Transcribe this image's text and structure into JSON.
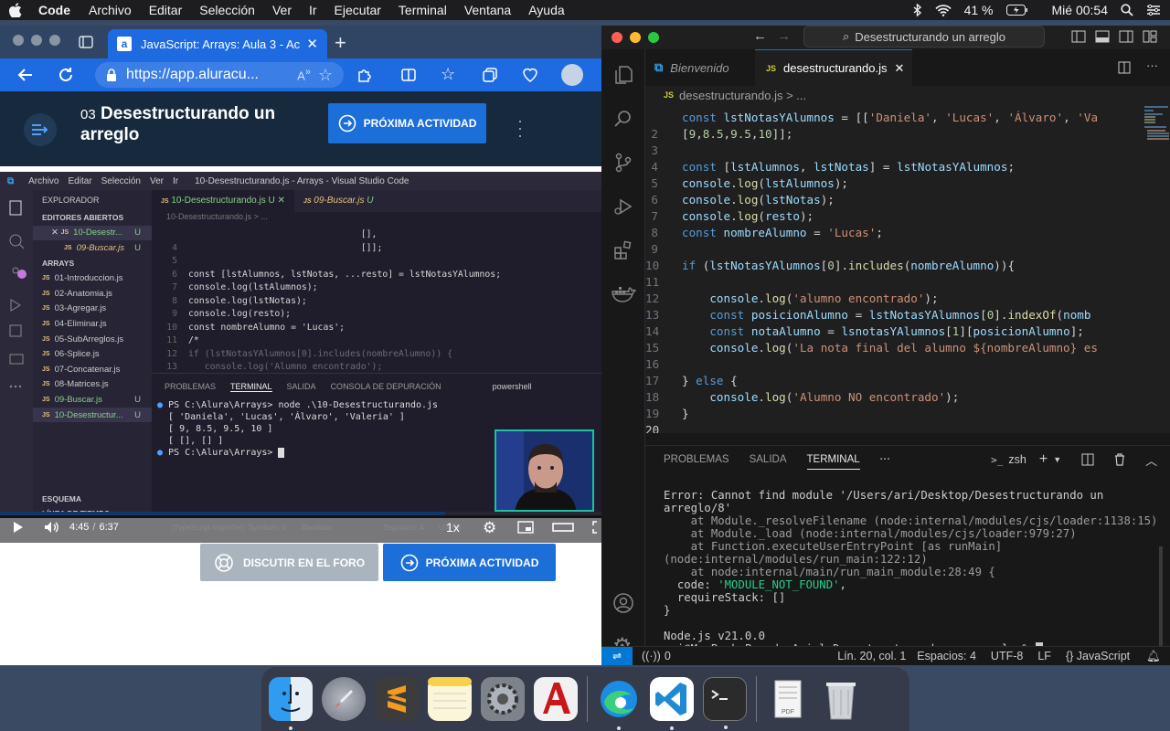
{
  "menubar": {
    "apple": "",
    "app": "Code",
    "items": [
      "Archivo",
      "Editar",
      "Selección",
      "Ver",
      "Ir",
      "Ejecutar",
      "Terminal",
      "Ventana",
      "Ayuda"
    ],
    "battery": "41 %",
    "clock": "Mié 00:54"
  },
  "browser": {
    "tab_title": "JavaScript: Arrays: Aula 3 - Ac",
    "url": "https://app.aluracu...",
    "lesson_number": "03",
    "lesson_title": "Desestructurando un arreglo",
    "next_activity": "PRÓXIMA ACTIVIDAD",
    "forum_button": "DISCUTIR EN EL FORO",
    "next_activity_bottom": "PRÓXIMA ACTIVIDAD",
    "video": {
      "time_current": "4:45",
      "time_total": "6:37",
      "speed": "1x",
      "progress": 0.74,
      "inner_titlebar": {
        "menu": [
          "Archivo",
          "Editar",
          "Selección",
          "Ver",
          "Ir"
        ],
        "title": "10-Desestructurando.js - Arrays - Visual Studio Code"
      },
      "explorer_label": "EXPLORADOR",
      "open_editors_label": "EDITORES ABIERTOS",
      "open_editors": [
        {
          "name": "10-Desestr...",
          "status": "U"
        },
        {
          "name": "09-Buscar.js",
          "status": "U"
        }
      ],
      "folder_label": "ARRAYS",
      "files": [
        {
          "name": "01-Introduccion.js",
          "status": ""
        },
        {
          "name": "02-Anatomia.js",
          "status": ""
        },
        {
          "name": "03-Agregar.js",
          "status": ""
        },
        {
          "name": "04-Eliminar.js",
          "status": ""
        },
        {
          "name": "05-SubArreglos.js",
          "status": ""
        },
        {
          "name": "06-Splice.js",
          "status": ""
        },
        {
          "name": "07-Concatenar.js",
          "status": ""
        },
        {
          "name": "08-Matrices.js",
          "status": ""
        },
        {
          "name": "09-Buscar.js",
          "status": "U"
        },
        {
          "name": "10-Desestructur...",
          "status": "U"
        }
      ],
      "outline_label": "ESQUEMA",
      "timeline_label": "LÍNEA DE TIEMPO",
      "editor_tabs": [
        {
          "name": "10-Desestructurando.js",
          "status": "U"
        },
        {
          "name": "09-Buscar.js",
          "status": "U"
        }
      ],
      "breadcrumb": "10-Desestructurando.js > ...",
      "code_lines": [
        {
          "n": "",
          "text": "                                [],"
        },
        {
          "n": "4",
          "text": "                                []];"
        },
        {
          "n": "5",
          "text": ""
        },
        {
          "n": "6",
          "text": "const [lstAlumnos, lstNotas, ...resto] = lstNotasYAlumnos;"
        },
        {
          "n": "7",
          "text": "console.log(lstAlumnos);"
        },
        {
          "n": "8",
          "text": "console.log(lstNotas);"
        },
        {
          "n": "9",
          "text": "console.log(resto);"
        },
        {
          "n": "10",
          "text": "const nombreAlumno = 'Lucas';"
        },
        {
          "n": "11",
          "text": "/*"
        },
        {
          "n": "12",
          "text": "if (lstNotasYAlumnos[0].includes(nombreAlumno)) {"
        },
        {
          "n": "13",
          "text": "   console.log('Alumno encontrado');"
        }
      ],
      "terminal_tabs": [
        "PROBLEMAS",
        "TERMINAL",
        "SALIDA",
        "CONSOLA DE DEPURACIÓN"
      ],
      "terminal_shell": "powershell",
      "terminal_lines": [
        "PS C:\\Alura\\Arrays> node .\\10-Desestructurando.js",
        "[ 'Daniela', 'Lucas', 'Álvaro', 'Valeria' ]",
        "[ 9, 8.5, 9.5, 10 ]",
        "[ [], [] ]",
        "PS C:\\Alura\\Arrays> "
      ],
      "status_fragments": [
        "[TypeScript Importer]: Symbols: 0",
        "Blackbox",
        "Espacios: 4",
        "UTF-8",
        "Babel JavaScript"
      ]
    }
  },
  "vscode": {
    "search": "Desestructurando un arreglo",
    "tabs": [
      {
        "name": "Bienvenido",
        "active": false
      },
      {
        "name": "desestructurando.js",
        "active": true
      }
    ],
    "breadcrumb": "desestructurando.js > ...",
    "code": [
      {
        "n": "",
        "html": "<span class='kw'>const</span> <span class='vr'>lstNotasYAlumnos</span> = [[<span class='st'>'Daniela'</span>, <span class='st'>'Lucas'</span>, <span class='st'>'Álvaro'</span>, <span class='st'>'Va</span>"
      },
      {
        "n": "2",
        "html": "[<span class='nm'>9</span>,<span class='nm'>8.5</span>,<span class='nm'>9.5</span>,<span class='nm'>10</span>]];"
      },
      {
        "n": "3",
        "html": ""
      },
      {
        "n": "4",
        "html": "<span class='kw'>const</span> [<span class='vr'>lstAlumnos</span>, <span class='vr'>lstNotas</span>] = <span class='vr'>lstNotasYAlumnos</span>;"
      },
      {
        "n": "5",
        "html": "<span class='vr'>console</span>.<span class='fn'>log</span>(<span class='vr'>lstAlumnos</span>);"
      },
      {
        "n": "6",
        "html": "<span class='vr'>console</span>.<span class='fn'>log</span>(<span class='vr'>lstNotas</span>);"
      },
      {
        "n": "7",
        "html": "<span class='vr'>console</span>.<span class='fn'>log</span>(<span class='vr'>resto</span>);"
      },
      {
        "n": "8",
        "html": "<span class='kw'>const</span> <span class='vr'>nombreAlumno</span> = <span class='st'>'Lucas'</span>;"
      },
      {
        "n": "9",
        "html": ""
      },
      {
        "n": "10",
        "html": "<span class='kw'>if</span> (<span class='vr'>lstNotasYAlumnos</span>[<span class='nm'>0</span>].<span class='fn'>includes</span>(<span class='vr'>nombreAlumno</span>)){"
      },
      {
        "n": "11",
        "html": ""
      },
      {
        "n": "12",
        "html": "    <span class='vr'>console</span>.<span class='fn'>log</span>(<span class='st'>'alumno encontrado'</span>);"
      },
      {
        "n": "13",
        "html": "    <span class='kw'>const</span> <span class='vr'>posicionAlumno</span> = <span class='vr'>lstNotasYAlumnos</span>[<span class='nm'>0</span>].<span class='fn'>indexOf</span>(<span class='vr'>nomb</span>"
      },
      {
        "n": "14",
        "html": "    <span class='kw'>const</span> <span class='vr'>notaAlumno</span> = <span class='vr'>lsnotasYAlumnos</span>[<span class='nm'>1</span>][<span class='vr'>posicionAlumno</span>];"
      },
      {
        "n": "15",
        "html": "    <span class='vr'>console</span>.<span class='fn'>log</span>(<span class='st'>'La nota final del alumno ${nombreAlumno} es</span>"
      },
      {
        "n": "16",
        "html": ""
      },
      {
        "n": "17",
        "html": "} <span class='kw'>else</span> {"
      },
      {
        "n": "18",
        "html": "    <span class='vr'>console</span>.<span class='fn'>log</span>(<span class='st'>'Alumno NO encontrado'</span>);"
      },
      {
        "n": "19",
        "html": "}"
      },
      {
        "n": "20",
        "html": ""
      }
    ],
    "panel_tabs": [
      "PROBLEMAS",
      "SALIDA",
      "TERMINAL"
    ],
    "panel_more": "···",
    "shell": "zsh",
    "terminal": [
      "Error: Cannot find module '/Users/ari/Desktop/Desestructurando un arreglo/8'",
      "    at Module._resolveFilename (node:internal/modules/cjs/loader:1138:15)",
      "    at Module._load (node:internal/modules/cjs/loader:979:27)",
      "    at Function.executeUserEntryPoint [as runMain] (node:internal/modules/run_main:122:12)",
      "    at node:internal/main/run_main_module:28:49 {",
      "  code: 'MODULE_NOT_FOUND',",
      "  requireStack: []",
      "}",
      "",
      "Node.js v21.0.0",
      "ari@MacBook-Pro-de-Ariel Desestructurando un arreglo % "
    ],
    "status": {
      "ports": "0",
      "position": "Lín. 20, col. 1",
      "spaces": "Espacios: 4",
      "encoding": "UTF-8",
      "eol": "LF",
      "language": "{} JavaScript"
    },
    "settings_badge": "1"
  },
  "dock": {
    "apps": [
      "finder-icon",
      "launchpad-icon",
      "sublime-icon",
      "notes-icon",
      "system-preferences-icon",
      "autocad-icon",
      "edge-icon",
      "vscode-icon",
      "terminal-icon",
      "pdf-stack-icon",
      "trash-icon"
    ]
  },
  "colors": {
    "alura_blue": "#1e6ae0",
    "alura_dark": "#172a3d",
    "vscode_bg": "#1f1f1f",
    "vscode_accent": "#0078d4"
  }
}
